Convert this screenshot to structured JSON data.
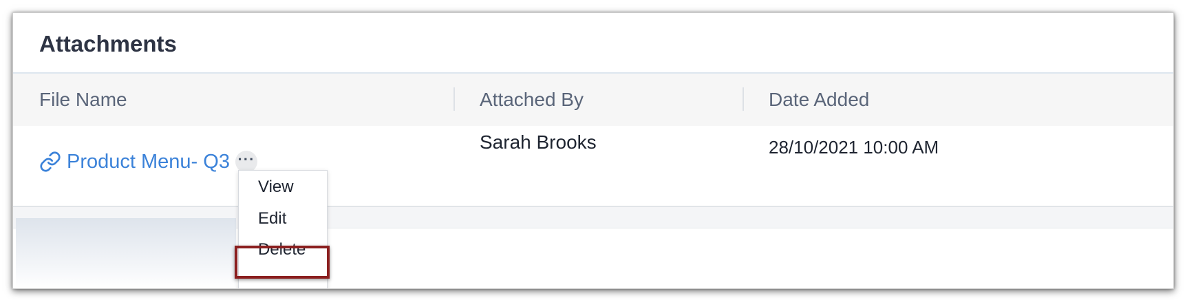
{
  "panel": {
    "title": "Attachments"
  },
  "table": {
    "columns": [
      "File Name",
      "Attached By",
      "Date Added"
    ],
    "rows": [
      {
        "file_name": "Product Menu- Q3",
        "attached_by": "Sarah Brooks",
        "date_added": "28/10/2021 10:00 AM"
      }
    ]
  },
  "row_actions": {
    "more_label": "···"
  },
  "context_menu": {
    "items": [
      "View",
      "Edit",
      "Delete"
    ],
    "highlighted": "Delete"
  },
  "icons": {
    "file_link": "link-icon",
    "more": "more-horizontal-icon"
  },
  "colors": {
    "link": "#3b82d9",
    "highlight_border": "#8b1f1f",
    "title": "#2e3444"
  }
}
